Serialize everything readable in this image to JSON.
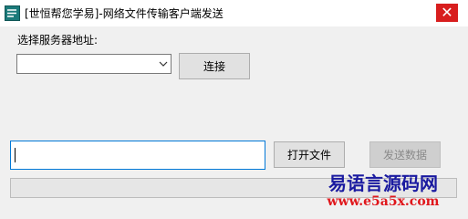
{
  "window": {
    "title": "[世恒帮您学易]-网络文件传输客户端发送",
    "close_glyph": "✕",
    "close_color": "#d81e1e"
  },
  "server": {
    "label": "选择服务器地址:",
    "address_value": "",
    "connect_label": "连接"
  },
  "file": {
    "path_value": "",
    "open_label": "打开文件",
    "send_label": "发送数据"
  },
  "progress": {
    "value": 0
  },
  "watermark": {
    "line1": "易语言源码网",
    "line2": "www.e5a5x.com"
  }
}
